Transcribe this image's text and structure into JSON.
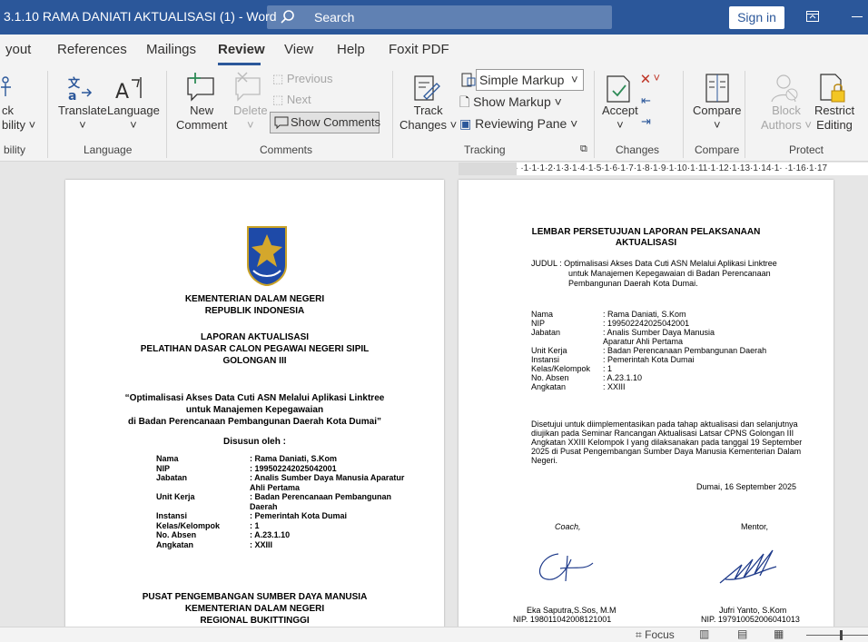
{
  "window": {
    "title": "3.1.10 RAMA DANIATI AKTUALISASI (1)  -  Word",
    "search_placeholder": "Search",
    "signin_label": "Sign in"
  },
  "tabs": [
    "yout",
    "References",
    "Mailings",
    "Review",
    "View",
    "Help",
    "Foxit PDF"
  ],
  "active_tab": "Review",
  "ribbon": {
    "accessibility": {
      "label1": "ck",
      "label2": "bility",
      "group": "bility"
    },
    "language": {
      "translate": "Translate",
      "language": "Language",
      "group": "Language"
    },
    "comments": {
      "new_line1": "New",
      "new_line2": "Comment",
      "delete": "Delete",
      "previous": "Previous",
      "next": "Next",
      "show_comments": "Show Comments",
      "group": "Comments"
    },
    "tracking": {
      "track_line1": "Track",
      "track_line2": "Changes",
      "markup_value": "Simple Markup",
      "show_markup": "Show Markup",
      "reviewing_pane": "Reviewing Pane",
      "group": "Tracking"
    },
    "changes": {
      "accept": "Accept",
      "group": "Changes"
    },
    "compare": {
      "compare": "Compare",
      "group": "Compare"
    },
    "protect": {
      "block_line1": "Block",
      "block_line2": "Authors",
      "restrict_line1": "Restrict",
      "restrict_line2": "Editing",
      "group": "Protect"
    }
  },
  "ruler_text": "·1·3·1·2·1·1·1·  ·1·1·1·2·1·3·1·4·1·5·1·6·1·7·1·8·1·9·1·10·1·11·1·12·1·13·1·14·1·  ·1·16·1·17",
  "page1": {
    "ministry": "KEMENTERIAN DALAM NEGERI",
    "republic": "REPUBLIK INDONESIA",
    "report": "LAPORAN AKTUALISASI",
    "training": "PELATIHAN DASAR CALON PEGAWAI NEGERI SIPIL",
    "group": "GOLONGAN III",
    "title_line1": "“Optimalisasi Akses Data Cuti ASN Melalui Aplikasi Linktree",
    "title_line2": "untuk Manajemen Kepegawaian",
    "title_line3": "di Badan Perencanaan Pembangunan Daerah Kota Dumai”",
    "compiled_by": "Disusun oleh :",
    "fields": [
      {
        "label": "Nama",
        "value": ": Rama Daniati, S.Kom"
      },
      {
        "label": "NIP",
        "value": ": 199502242025042001"
      },
      {
        "label": "Jabatan",
        "value": ": Analis Sumber Daya Manusia Aparatur"
      },
      {
        "label": "",
        "value": "Ahli Pertama"
      },
      {
        "label": "Unit Kerja",
        "value": ": Badan Perencanaan Pembangunan"
      },
      {
        "label": "",
        "value": "Daerah"
      },
      {
        "label": "Instansi",
        "value": ": Pemerintah Kota Dumai"
      },
      {
        "label": "Kelas/Kelompok",
        "value": ": 1"
      },
      {
        "label": "No. Absen",
        "value": ": A.23.1.10"
      },
      {
        "label": "Angkatan",
        "value": ": XXIII"
      }
    ],
    "footer_line1": "PUSAT PENGEMBANGAN SUMBER DAYA MANUSIA",
    "footer_line2": "KEMENTERIAN DALAM NEGERI",
    "footer_line3": "REGIONAL BUKITTINGGI"
  },
  "page2": {
    "heading_line1": "LEMBAR PERSETUJUAN LAPORAN PELAKSANAAN",
    "heading_line2": "AKTUALISASI",
    "judul_line1": "JUDUL : Optimalisasi Akses Data Cuti ASN Melalui Aplikasi Linktree",
    "judul_line2": "untuk Manajemen Kepegawaian di Badan Perencanaan",
    "judul_line3": "Pembangunan Daerah Kota Dumai.",
    "fields": [
      {
        "label": "Nama",
        "value": ": Rama Daniati, S.Kom"
      },
      {
        "label": "NIP",
        "value": ": 199502242025042001"
      },
      {
        "label": "Jabatan",
        "value": ": Analis Sumber Daya Manusia"
      },
      {
        "label": "",
        "value": "  Aparatur Ahli Pertama"
      },
      {
        "label": "Unit Kerja",
        "value": ": Badan Perencanaan Pembangunan Daerah"
      },
      {
        "label": "Instansi",
        "value": ": Pemerintah Kota Dumai"
      },
      {
        "label": "Kelas/Kelompok",
        "value": ": 1"
      },
      {
        "label": "No. Absen",
        "value": ": A.23.1.10"
      },
      {
        "label": "Angkatan",
        "value": ": XXIII"
      }
    ],
    "approval_lines": [
      "Disetujui untuk diimplementasikan pada tahap aktualisasi dan selanjutnya",
      "diujikan pada Seminar Rancangan Aktualisasi Latsar CPNS Golongan III",
      "Angkatan XXIII Kelompok I yang dilaksanakan pada tanggal 19 September",
      "2025 di Pusat Pengembangan Sumber Daya Manusia Kementerian Dalam",
      "Negeri."
    ],
    "date": "Dumai, 16 September 2025",
    "coach_label": "Coach,",
    "mentor_label": "Mentor,",
    "coach_name": "Eka Saputra,S.Sos, M.M",
    "coach_nip": "NIP. 198011042008121001",
    "mentor_name": "Jufri Yanto, S.Kom",
    "mentor_nip": "NIP. 197910052006041013"
  },
  "statusbar": {
    "focus": "Focus"
  },
  "colors": {
    "titlebar": "#2b579a",
    "ribbon": "#f3f3f3",
    "canvas": "#e6e6e6"
  }
}
